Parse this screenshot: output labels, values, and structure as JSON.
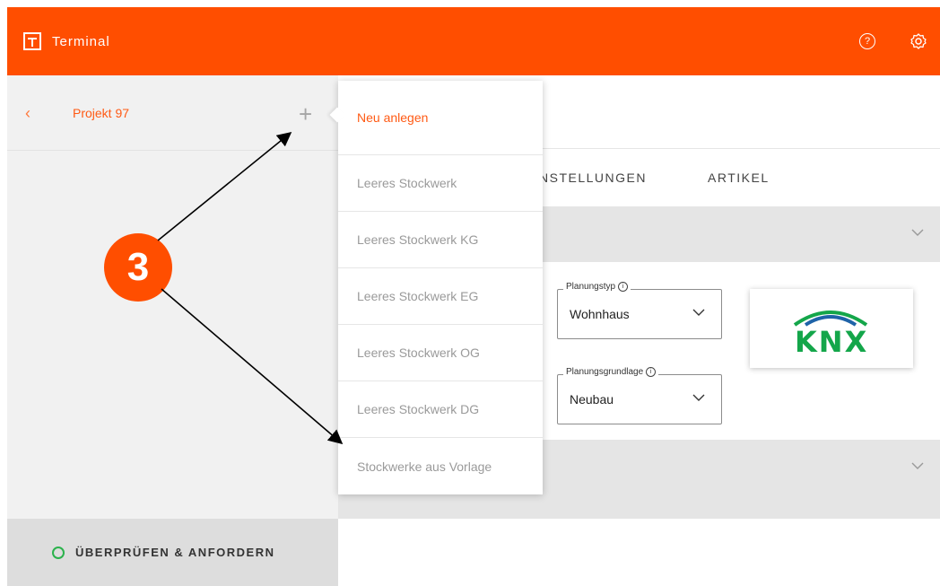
{
  "app": {
    "name": "Terminal"
  },
  "sidebar": {
    "project_name": "Projekt 97",
    "footer_label": "ÜBERPRÜFEN & ANFORDERN"
  },
  "tabs": [
    {
      "label": "NSTELLUNGEN"
    },
    {
      "label": "ARTIKEL"
    }
  ],
  "dropdown": {
    "items": [
      {
        "label": "Neu anlegen"
      },
      {
        "label": "Leeres Stockwerk"
      },
      {
        "label": "Leeres Stockwerk KG"
      },
      {
        "label": "Leeres Stockwerk EG"
      },
      {
        "label": "Leeres Stockwerk OG"
      },
      {
        "label": "Leeres Stockwerk DG"
      },
      {
        "label": "Stockwerke aus Vorlage"
      }
    ]
  },
  "fields": {
    "planungstyp": {
      "label": "Planungstyp",
      "value": "Wohnhaus"
    },
    "planungsgrundlage": {
      "label": "Planungsgrundlage",
      "value": "Neubau"
    }
  },
  "logo": {
    "text": "KNX"
  },
  "annotation": {
    "number": "3"
  },
  "colors": {
    "brand": "#ff4e00",
    "accent_text": "#ff5a14",
    "status_ok": "#2bb24c",
    "knx_green": "#14a64a",
    "knx_blue": "#1f63a8"
  }
}
